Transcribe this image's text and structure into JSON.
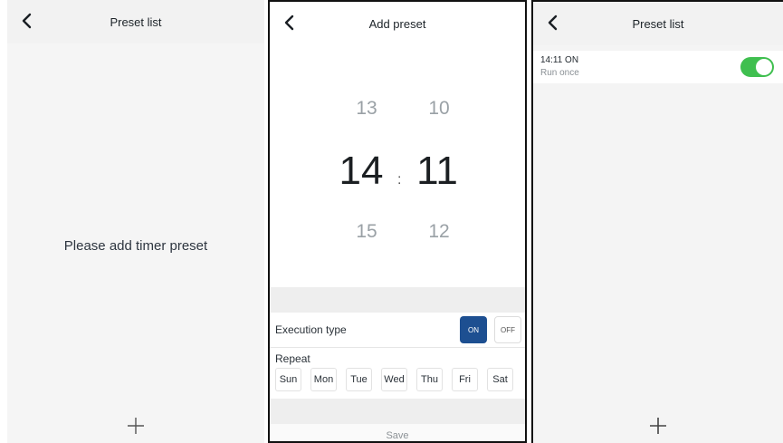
{
  "screens": {
    "empty_list": {
      "title": "Preset list",
      "empty_message": "Please add timer preset"
    },
    "add_preset": {
      "title": "Add preset",
      "picker": {
        "hour_prev": "13",
        "hour_selected": "14",
        "hour_next": "15",
        "minute_prev": "10",
        "minute_selected": "11",
        "minute_next": "12",
        "separator": ":"
      },
      "execution_type": {
        "label": "Execution type",
        "on_label": "ON",
        "off_label": "OFF",
        "selected": "ON"
      },
      "repeat": {
        "label": "Repeat",
        "days": [
          "Sun",
          "Mon",
          "Tue",
          "Wed",
          "Thu",
          "Fri",
          "Sat"
        ]
      },
      "save_label": "Save"
    },
    "preset_list": {
      "title": "Preset list",
      "items": [
        {
          "title": "14:11  ON",
          "subtitle": "Run once",
          "enabled": true
        }
      ]
    }
  },
  "colors": {
    "accent_blue": "#1d4f91",
    "toggle_green": "#3fbf4f"
  },
  "icons": [
    "back-icon",
    "plus-icon"
  ]
}
